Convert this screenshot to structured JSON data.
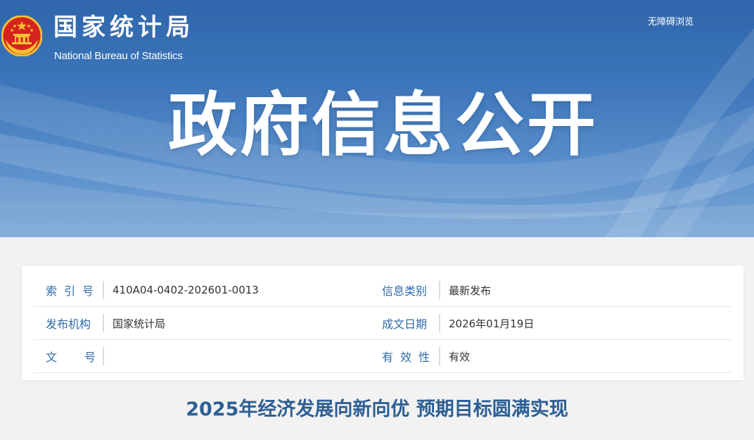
{
  "header": {
    "site_name_cn": "国家统计局",
    "site_name_en": "National Bureau of Statistics",
    "accessibility_link": "无障碍浏览",
    "banner_title": "政府信息公开",
    "emblem_icon": "national-emblem-icon"
  },
  "meta": {
    "index_no": {
      "label": "索引号",
      "value": "410A04-0402-202601-0013"
    },
    "category": {
      "label": "信息类别",
      "value": "最新发布"
    },
    "issuer": {
      "label": "发布机构",
      "value": "国家统计局"
    },
    "date": {
      "label": "成文日期",
      "value": "2026年01月19日"
    },
    "doc_no": {
      "label": "文号",
      "value": ""
    },
    "validity": {
      "label": "有效性",
      "value": "有效"
    }
  },
  "article": {
    "title": "2025年经济发展向新向优 预期目标圆满实现"
  },
  "colors": {
    "banner_blue": "#2f66ab",
    "label_blue": "#2f6aa8",
    "title_blue": "#2d5f94",
    "emblem_red": "#d6231e",
    "emblem_gold": "#f2c230"
  }
}
